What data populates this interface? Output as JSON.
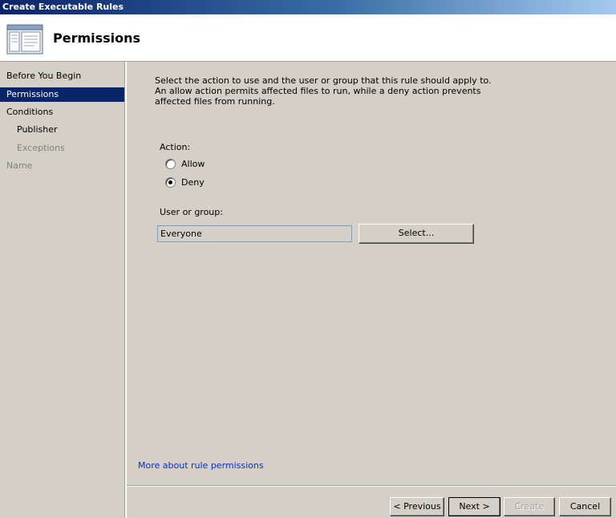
{
  "window": {
    "title": "Create Executable Rules"
  },
  "header": {
    "title": "Permissions",
    "icon": "wizard-page-icon"
  },
  "sidebar": {
    "steps": [
      {
        "label": "Before You Begin",
        "state": "normal"
      },
      {
        "label": "Permissions",
        "state": "active"
      },
      {
        "label": "Conditions",
        "state": "normal"
      },
      {
        "label": "Publisher",
        "state": "normal"
      },
      {
        "label": "Exceptions",
        "state": "disabled"
      },
      {
        "label": "Name",
        "state": "disabled"
      }
    ]
  },
  "main": {
    "description": [
      "Select the action to use and the user or group that this rule should apply to.",
      "An allow action permits affected files to run, while a deny action prevents",
      "affected files from running."
    ],
    "action_label": "Action:",
    "options": [
      {
        "label": "Allow",
        "selected": false
      },
      {
        "label": "Deny",
        "selected": true
      }
    ],
    "user_group_label": "User or group:",
    "user_group_value": "Everyone",
    "select_button": "Select...",
    "more_link": "More about rule permissions"
  },
  "footer": {
    "previous": "< Previous",
    "next": "Next >",
    "create": "Create",
    "cancel": "Cancel"
  }
}
